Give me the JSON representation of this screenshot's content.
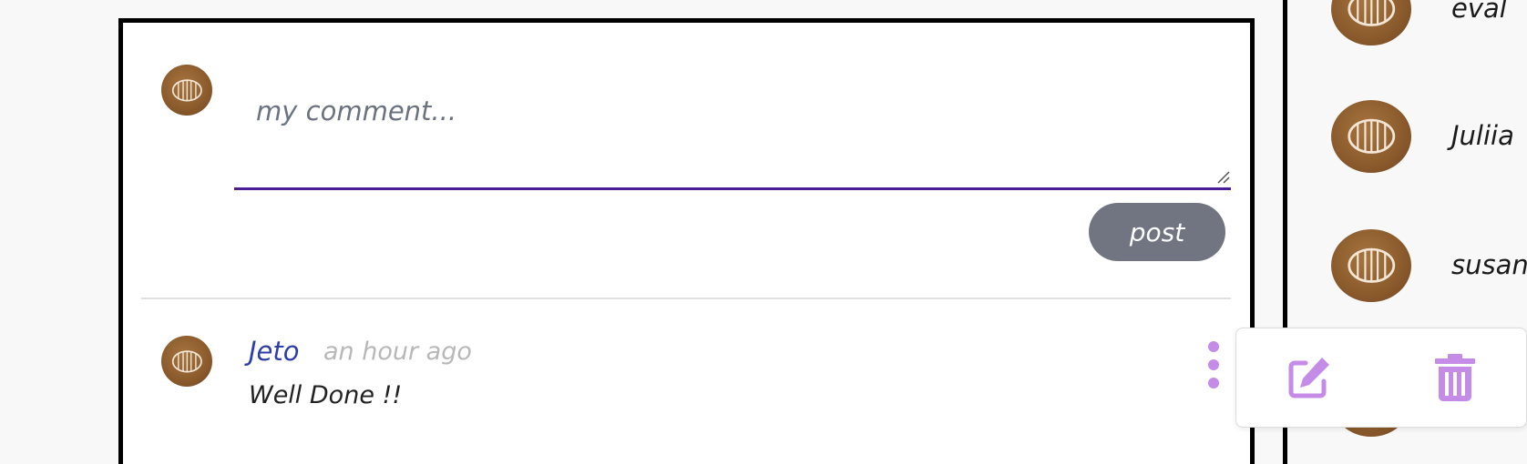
{
  "composer": {
    "placeholder": "my comment...",
    "value": "",
    "post_label": "post"
  },
  "comments": [
    {
      "author": "Jeto",
      "time": "an hour ago",
      "text": "Well Done !!"
    }
  ],
  "users": [
    {
      "name": "eval"
    },
    {
      "name": "Juliia"
    },
    {
      "name": "susan"
    }
  ],
  "colors": {
    "accent": "#4c1d95",
    "author_link": "#2e3ea8",
    "post_button": "#717582",
    "menu_icon": "#c48ce6",
    "avatar": "#8a5a2c"
  },
  "icons": {
    "avatar": "barrel-icon",
    "more": "kebab-menu-icon",
    "edit": "edit-icon",
    "delete": "trash-icon"
  }
}
